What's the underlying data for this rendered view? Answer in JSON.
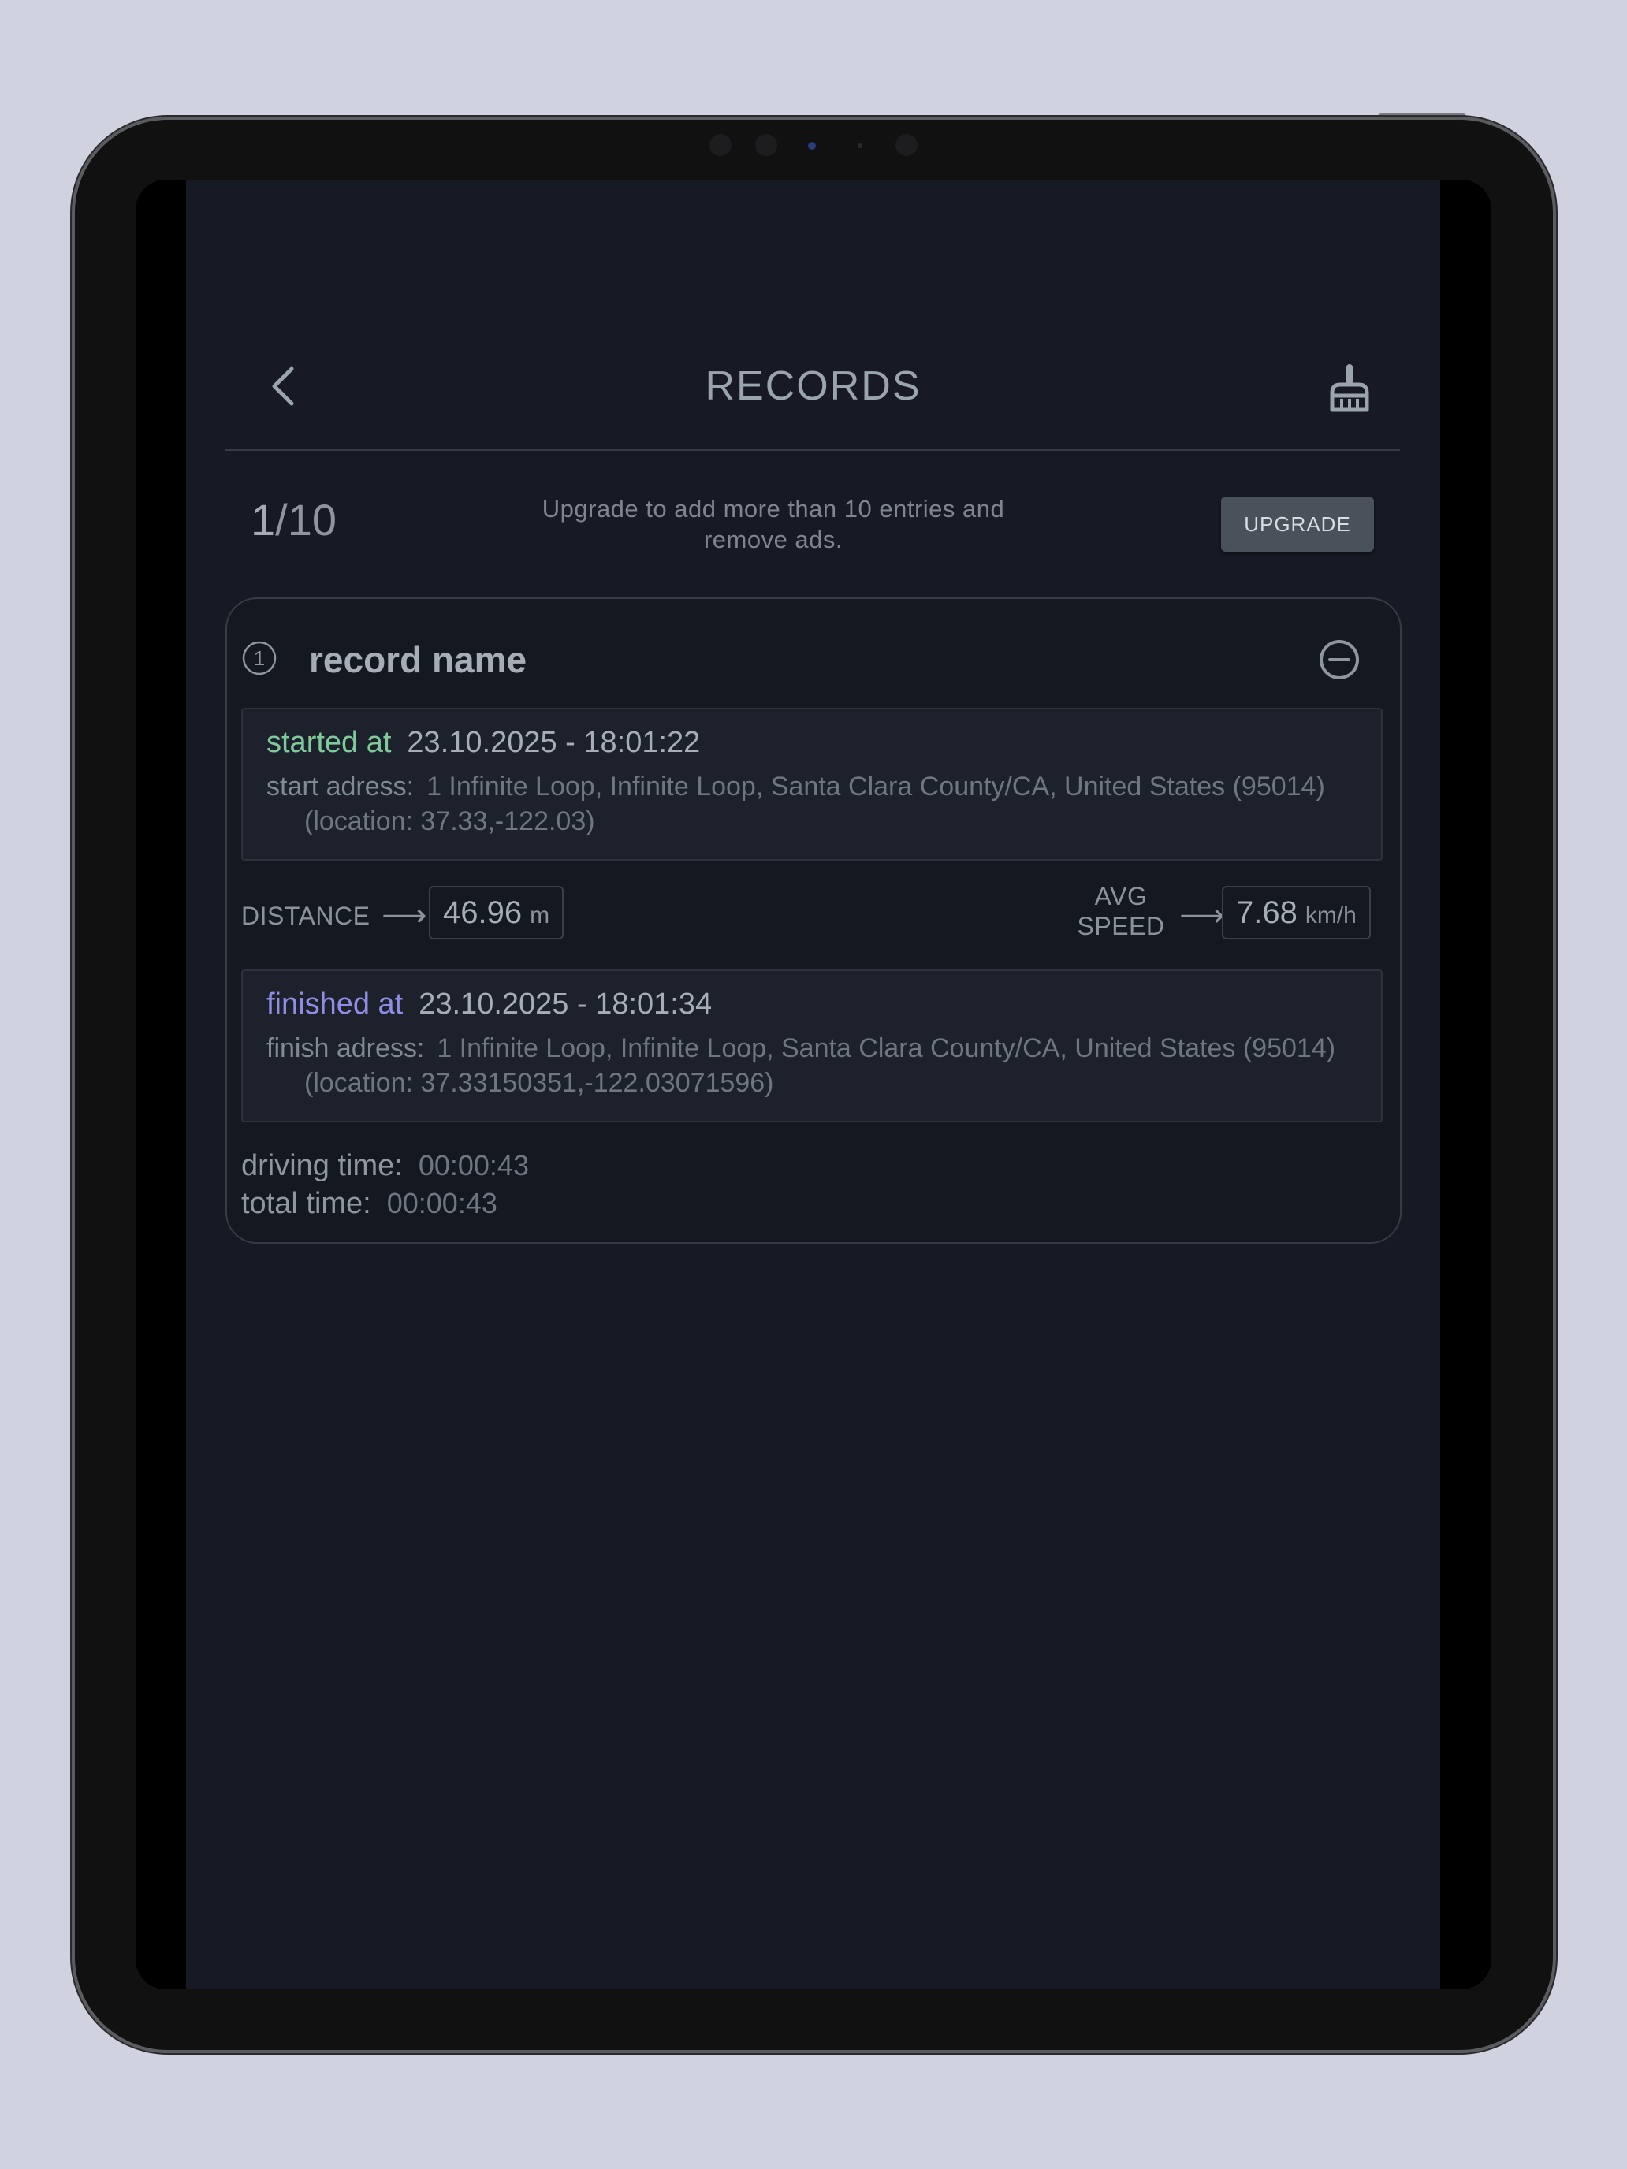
{
  "header": {
    "title": "RECORDS"
  },
  "limit": {
    "current": "1",
    "separator": "/",
    "max": "10",
    "message": "Upgrade to add more than 10 entries and remove ads.",
    "upgrade_label": "UPGRADE"
  },
  "record": {
    "index_label": "1",
    "name": "record name",
    "start": {
      "label": "started at",
      "datetime": "23.10.2025 - 18:01:22",
      "address_label": "start adress:",
      "address": "1 Infinite Loop, Infinite Loop, Santa Clara County/CA, United States (95014)",
      "location": "(location: 37.33,-122.03)"
    },
    "distance": {
      "label": "DISTANCE",
      "value": "46.96",
      "unit": "m"
    },
    "avg_speed": {
      "label": "AVG SPEED",
      "value": "7.68",
      "unit": "km/h"
    },
    "finish": {
      "label": "finished at",
      "datetime": "23.10.2025 - 18:01:34",
      "address_label": "finish adress:",
      "address": "1 Infinite Loop, Infinite Loop, Santa Clara County/CA, United States (95014)",
      "location": "(location: 37.33150351,-122.03071596)"
    },
    "driving_time": {
      "label": "driving time:",
      "value": "00:00:43"
    },
    "total_time": {
      "label": "total time:",
      "value": "00:00:43"
    }
  },
  "icons": {
    "back": "chevron-left-icon",
    "clear": "broom-icon",
    "remove": "minus-circle-icon",
    "arrow": "arrow-right-icon",
    "index": "circled-number-icon"
  },
  "colors": {
    "background": "#171a24",
    "started_label": "#7fc99a",
    "finished_label": "#8f8ee6",
    "upgrade_button": "#49525b"
  }
}
